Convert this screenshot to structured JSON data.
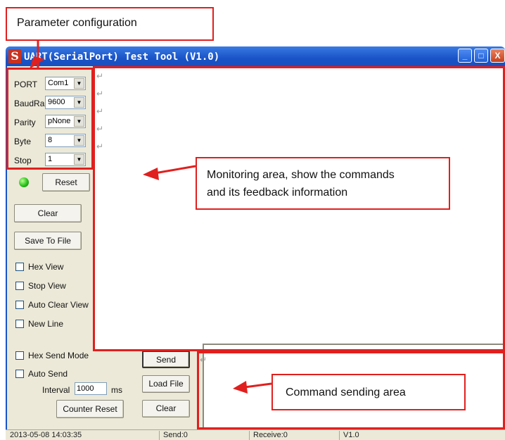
{
  "window": {
    "title": "UART(SerialPort) Test Tool (V1.0)",
    "controls": {
      "minimize": "_",
      "maximize": "□",
      "close": "X"
    }
  },
  "params": [
    {
      "label": "PORT",
      "value": "Com1"
    },
    {
      "label": "BaudRa",
      "value": "9600"
    },
    {
      "label": "Parity",
      "value": "pNone"
    },
    {
      "label": "Byte",
      "value": "8"
    },
    {
      "label": "Stop",
      "value": "1"
    }
  ],
  "controls": {
    "reset": "Reset",
    "clear": "Clear",
    "save_to_file": "Save To File",
    "view_options": [
      "Hex View",
      "Stop View",
      "Auto Clear View",
      "New Line"
    ],
    "hex_send_mode": "Hex Send Mode",
    "auto_send": "Auto Send",
    "interval_label": "Interval",
    "interval_value": "1000",
    "interval_unit": "ms",
    "counter_reset": "Counter Reset",
    "send": "Send",
    "load_file": "Load File",
    "send_clear": "Clear"
  },
  "status_bar": {
    "datetime": "2013-05-08 14:03:35",
    "send": "Send:0",
    "receive": "Receive:0",
    "version": "V1.0"
  },
  "annotations": {
    "parameter_configuration": "Parameter configuration",
    "monitoring_line1": "Monitoring area, show the commands",
    "monitoring_line2": "and its feedback information",
    "command_sending": "Command sending area"
  },
  "return_mark": "↵",
  "colors": {
    "annotation_red": "#e0201e",
    "titlebar_blue": "#1953c8",
    "window_face": "#ece9d8",
    "led_green": "#28c11c"
  },
  "icons": {
    "app": "app-logo-icon",
    "dropdown": "chevron-down-icon",
    "status_led": "status-led-icon",
    "return_mark": "return-arrow-icon"
  }
}
